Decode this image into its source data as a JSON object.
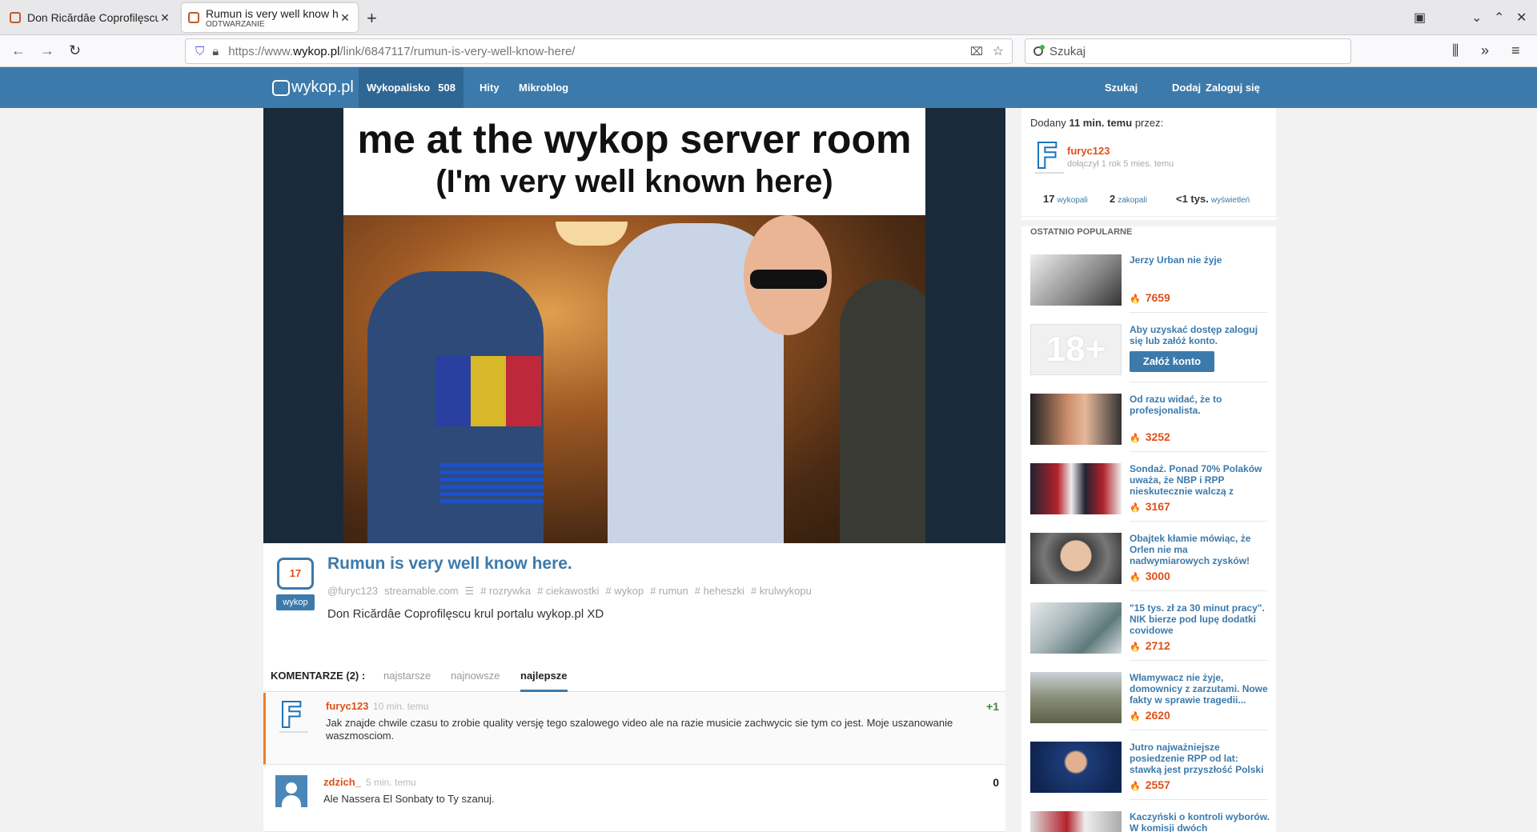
{
  "browser": {
    "tabs": [
      {
        "title": "Don Ricărdâe Coprofilęscu",
        "subtitle": ""
      },
      {
        "title": "Rumun is very well know here",
        "subtitle": "ODTWARZANIE"
      }
    ],
    "url_prefix": "https://www.",
    "url_domain": "wykop.pl",
    "url_path": "/link/6847117/rumun-is-very-well-know-here/",
    "search_placeholder": "Szukaj"
  },
  "header": {
    "logo": "wykop.pl",
    "nav": [
      {
        "label": "Wykopalisko",
        "count": "508"
      },
      {
        "label": "Hity"
      },
      {
        "label": "Mikroblog"
      }
    ],
    "right": [
      "Szukaj",
      "Dodaj",
      "Zaloguj się"
    ]
  },
  "meme": {
    "line1": "me at the wykop server room",
    "line2": "(I'm very well known here)",
    "colors": {
      "flag_blue": "#2a3fa8",
      "flag_yellow": "#f4cc1c",
      "flag_red": "#d6232f"
    }
  },
  "post": {
    "votes": "17",
    "vote_button": "wykop",
    "title": "Rumun is very well know here.",
    "author": "@furyc123",
    "source": "streamable.com",
    "tags": [
      "# rozrywka",
      "# ciekawostki",
      "# wykop",
      "# rumun",
      "# heheszki",
      "# krulwykopu"
    ],
    "description": "Don Ricărdâe Coprofilęscu krul portalu wykop.pl XD"
  },
  "comments": {
    "label": "KOMENTARZE (2) :",
    "sort_tabs": [
      "najstarsze",
      "najnowsze",
      "najlepsze"
    ],
    "items": [
      {
        "author": "furyc123",
        "time": "10 min. temu",
        "text": "Jak znajde chwile czasu to zrobie quality versję tego szalowego video ale na razie musicie zachwycic sie tym co jest. Moje uszanowanie waszmosciom.",
        "score": "+1",
        "avatar_letter": "F"
      },
      {
        "author": "zdzich_",
        "time": "5 min. temu",
        "text": "Ale Nassera El Sonbaty to Ty szanuj.",
        "score": "0"
      }
    ]
  },
  "sidebar": {
    "added_prefix": "Dodany",
    "added_time": "11 min. temu",
    "added_suffix": "przez:",
    "user": "furyc123",
    "avatar_letter": "F",
    "joined": "dołączył 1 rok 5 mies. temu",
    "stats": [
      {
        "value": "17",
        "label": "wykopali"
      },
      {
        "value": "2",
        "label": "zakopali"
      },
      {
        "value": "<1 tys.",
        "label": "wyświetleń"
      }
    ],
    "section_title": "OSTATNIO POPULARNE",
    "age_gate_text": "Aby uzyskać dostęp zaloguj się lub załóż konto.",
    "age_gate_badge": "18+",
    "age_gate_button": "Załóż konto",
    "items": [
      {
        "title": "Jerzy Urban nie żyje",
        "points": "7659"
      },
      {
        "title": "Od razu widać, że to profesjonalista.",
        "points": "3252"
      },
      {
        "title": "Sondaż. Ponad 70% Polaków uważa, że NBP i RPP nieskutecznie walczą z",
        "points": "3167"
      },
      {
        "title": "Obajtek kłamie mówiąc, że Orlen nie ma nadwymiarowych zysków!",
        "points": "3000"
      },
      {
        "title": "\"15 tys. zł za 30 minut pracy\". NIK bierze pod lupę dodatki covidowe",
        "points": "2712"
      },
      {
        "title": "Włamywacz nie żyje, domownicy z zarzutami. Nowe fakty w sprawie tragedii...",
        "points": "2620"
      },
      {
        "title": "Jutro najważniejsze posiedzenie RPP od lat: stawką jest przyszłość Polski",
        "points": "2557"
      },
      {
        "title": "Kaczyński o kontroli wyborów. W komisji dwóch",
        "points": ""
      }
    ]
  }
}
